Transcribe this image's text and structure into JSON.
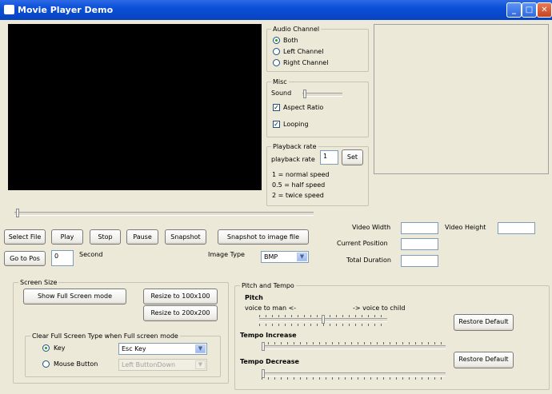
{
  "window": {
    "title": "Movie Player Demo"
  },
  "audio_channel": {
    "legend": "Audio Channel",
    "options": [
      "Both",
      "Left Channel",
      "Right Channel"
    ],
    "selected": "Both"
  },
  "misc": {
    "legend": "Misc",
    "sound_label": "Sound",
    "aspect_ratio_label": "Aspect Ratio",
    "aspect_ratio_checked": true,
    "looping_label": "Looping",
    "looping_checked": true
  },
  "playback_rate": {
    "legend": "Playback rate",
    "field_label": "playback rate",
    "value": "1",
    "set_label": "Set",
    "help": [
      "1 = normal speed",
      "0.5 = half speed",
      "2 = twice speed"
    ]
  },
  "buttons": {
    "select_file": "Select File",
    "play": "Play",
    "stop": "Stop",
    "pause": "Pause",
    "snapshot": "Snapshot",
    "snapshot_to_file": "Snapshot to image file",
    "go_to_pos": "Go to Pos"
  },
  "goto": {
    "value": "0",
    "unit": "Second"
  },
  "image_type": {
    "label": "Image Type",
    "value": "BMP"
  },
  "info": {
    "video_width_label": "Video Width",
    "video_height_label": "Video Height",
    "current_position_label": "Current Position",
    "total_duration_label": "Total Duration"
  },
  "screen_size": {
    "legend": "Screen Size",
    "full_screen": "Show Full Screen mode",
    "resize_100": "Resize to 100x100",
    "resize_200": "Resize to 200x200"
  },
  "clear_full_screen": {
    "legend": "Clear Full Screen Type when Full screen mode",
    "key_label": "Key",
    "key_value": "Esc Key",
    "mouse_label": "Mouse Button",
    "mouse_value": "Left ButtonDown",
    "selected": "Key"
  },
  "pitch_tempo": {
    "legend": "Pitch and Tempo",
    "pitch_label": "Pitch",
    "voice_man": "voice to man <-",
    "voice_child": "-> voice to child",
    "tempo_increase": "Tempo Increase",
    "tempo_decrease": "Tempo Decrease",
    "restore_default": "Restore Default"
  },
  "colors": {
    "titlebar": "#0a4fd8",
    "face": "#ece9d8"
  }
}
